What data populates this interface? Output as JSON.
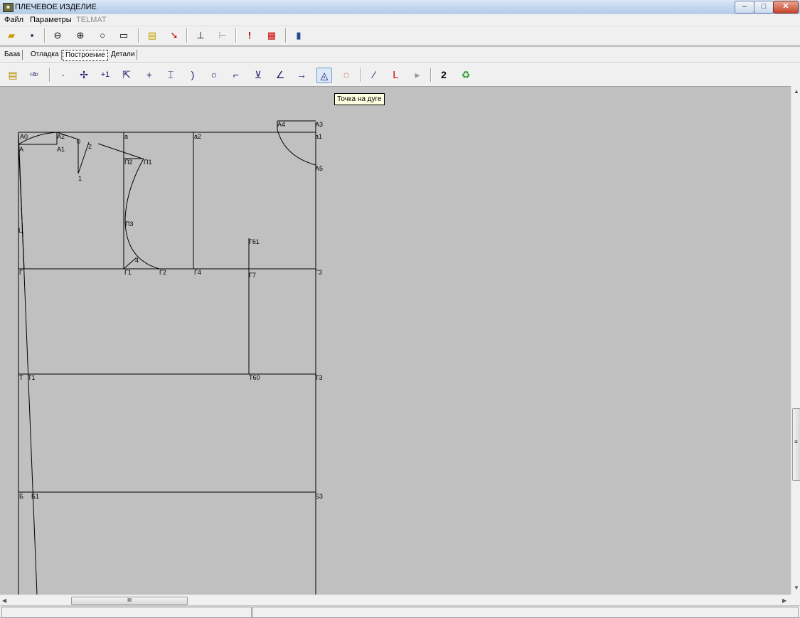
{
  "window": {
    "title": "ПЛЕЧЕВОЕ ИЗДЕЛИЕ",
    "minimize": "–",
    "maximize": "□",
    "close": "✕"
  },
  "menu": {
    "file": "Файл",
    "params": "Параметры",
    "telmat": "TELMAT"
  },
  "toolbar1": {
    "icons": [
      "open-folder-icon",
      "save-icon",
      "zoom-out-icon",
      "zoom-in-icon",
      "zoom-icon",
      "fit-page-icon",
      "document-icon",
      "pen-icon",
      "measure-icon",
      "measure-alt-icon",
      "info-icon",
      "palette-icon",
      "export-icon"
    ]
  },
  "tabs": [
    "База",
    "Отладка",
    "Построение",
    "Детали"
  ],
  "active_tab": "Построение",
  "toolbar2": {
    "buttons": [
      "edit-icon",
      "name-icon",
      "point-icon",
      "move-icon",
      "plus-one-icon",
      "select-icon",
      "cross-icon",
      "bracket-icon",
      "arc-right-icon",
      "circle-point-icon",
      "corner-icon",
      "intersection-icon",
      "angle-icon",
      "arrow-right-icon",
      "point-on-arc-icon",
      "circle-icon",
      "line-icon",
      "curve-icon",
      "play-icon",
      "number-icon",
      "recycle-icon"
    ],
    "number_label": "2"
  },
  "tooltip": "Точка на дуге",
  "drawing_labels": {
    "A0": "A0",
    "A": "A",
    "A2": "A2",
    "A1": "A1",
    "p0": "0",
    "p2": "2",
    "p1": "1",
    "a": "a",
    "P2": "П2",
    "P1": "П1",
    "P3": "П3",
    "p4": "4",
    "a2": "a2",
    "A4": "A4",
    "A3": "A3",
    "a1": "a1",
    "A5": "A5",
    "G61": "Г61",
    "G": "Г",
    "G1": "Г1",
    "G2": "Г2",
    "G4": "Г4",
    "G7": "Г7",
    "G3": "Г3",
    "T": "Т",
    "T1": "Т1",
    "T60": "Т60",
    "T3": "Т3",
    "B": "Б",
    "B1": "Б1",
    "B3": "Б3",
    "U": "Ц"
  },
  "scroll": {
    "h_thumb_text": "III",
    "v_thumb_text": "≡"
  }
}
